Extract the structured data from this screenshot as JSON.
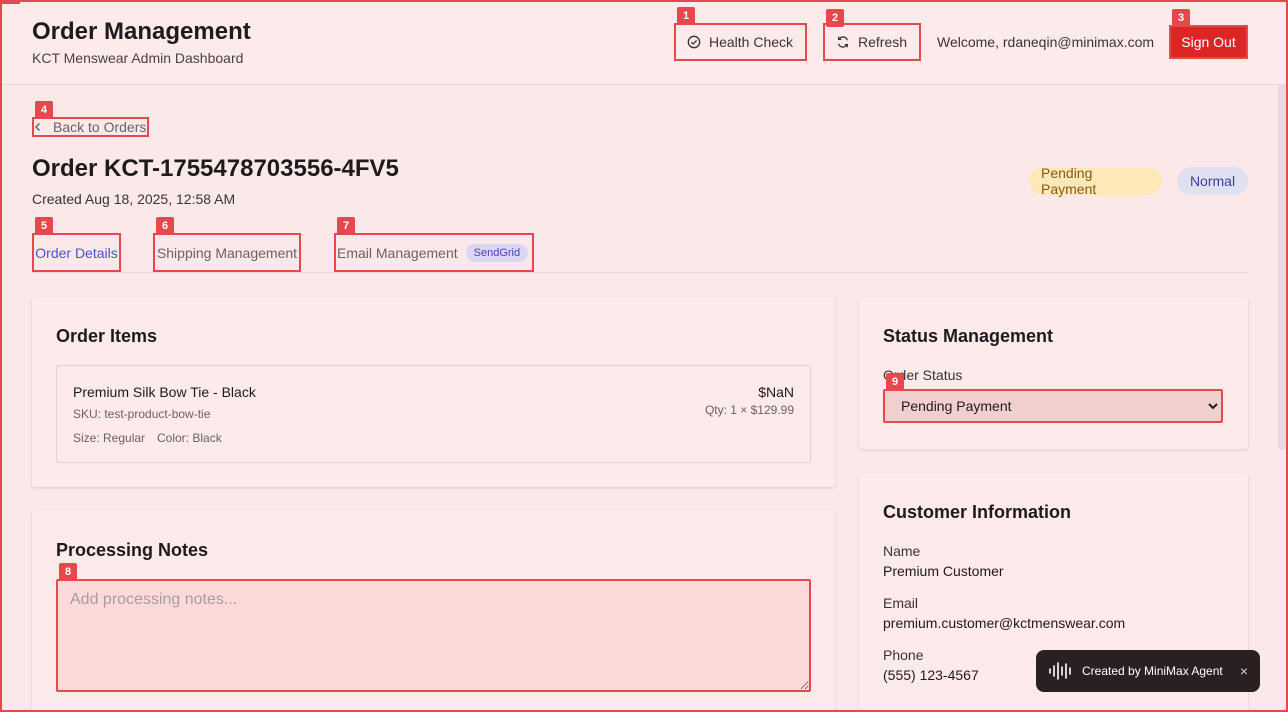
{
  "header": {
    "title": "Order Management",
    "subtitle": "KCT Menswear Admin Dashboard",
    "health_label": "Health Check",
    "refresh_label": "Refresh",
    "welcome": "Welcome, rdaneqin@minimax.com",
    "signout_label": "Sign Out"
  },
  "order": {
    "back_label": "Back to Orders",
    "title": "Order KCT-1755478703556-4FV5",
    "created": "Created Aug 18, 2025, 12:58 AM",
    "status_badge": "Pending Payment",
    "priority_badge": "Normal"
  },
  "tabs": [
    {
      "label": "Order Details",
      "active": true
    },
    {
      "label": "Shipping Management"
    },
    {
      "label": "Email Management",
      "pill": "SendGrid"
    }
  ],
  "items_card": {
    "title": "Order Items",
    "items": [
      {
        "name": "Premium Silk Bow Tie - Black",
        "sku": "SKU: test-product-bow-tie",
        "size": "Size: Regular",
        "color": "Color: Black",
        "price": "$NaN",
        "qty": "Qty: 1 × $129.99"
      }
    ]
  },
  "notes_card": {
    "title": "Processing Notes",
    "placeholder": "Add processing notes..."
  },
  "status_card": {
    "title": "Status Management",
    "label": "Order Status",
    "selected": "Pending Payment"
  },
  "customer_card": {
    "title": "Customer Information",
    "name_label": "Name",
    "name": "Premium Customer",
    "email_label": "Email",
    "email": "premium.customer@kctmenswear.com",
    "phone_label": "Phone",
    "phone": "(555) 123-4567"
  },
  "toast": {
    "text": "Created by MiniMax Agent",
    "close": "×"
  },
  "markers": [
    "1",
    "2",
    "3",
    "4",
    "5",
    "6",
    "7",
    "8",
    "9"
  ],
  "colors": {
    "accent": "#e5484d",
    "signout": "#dc2626",
    "active_tab": "#4c4fd1",
    "status_badge_bg": "#fde8b8",
    "priority_badge_bg": "#dfe0f2"
  }
}
